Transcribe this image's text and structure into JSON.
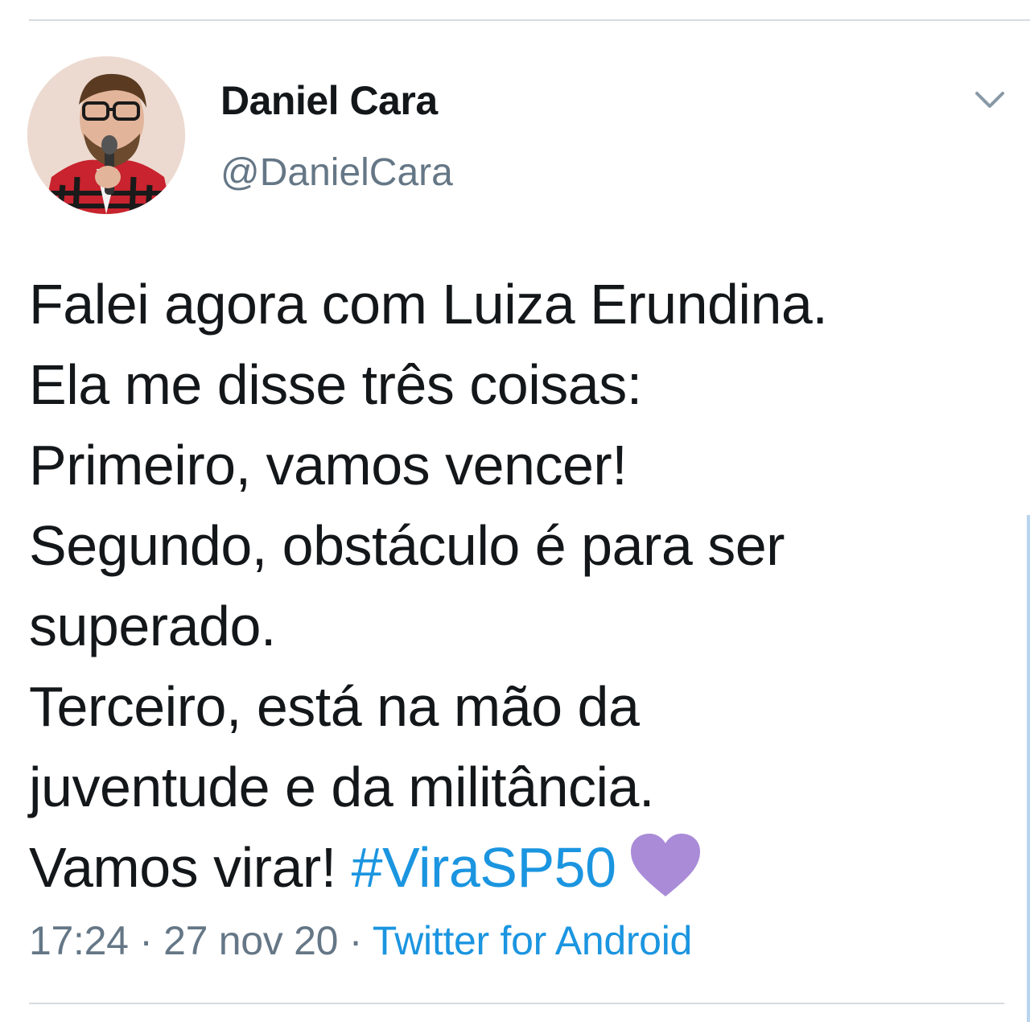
{
  "tweet": {
    "author": {
      "name": "Daniel Cara",
      "handle": "@DanielCara"
    },
    "lines": [
      "Falei agora com Luiza Erundina.",
      "Ela me disse três coisas:",
      "Primeiro, vamos vencer!",
      "Segundo, obstáculo é para ser",
      "superado.",
      "Terceiro, está na mão da",
      "juventude e da militância.",
      "Vamos virar! "
    ],
    "hashtag": "#ViraSP50",
    "emoji": "purple-heart",
    "time": "17:24",
    "separator": " · ",
    "date": "27 nov 20",
    "source": "Twitter for Android"
  },
  "colors": {
    "text": "#14171a",
    "secondary": "#657786",
    "link": "#1b95e0",
    "heart": "#a98bd8"
  }
}
